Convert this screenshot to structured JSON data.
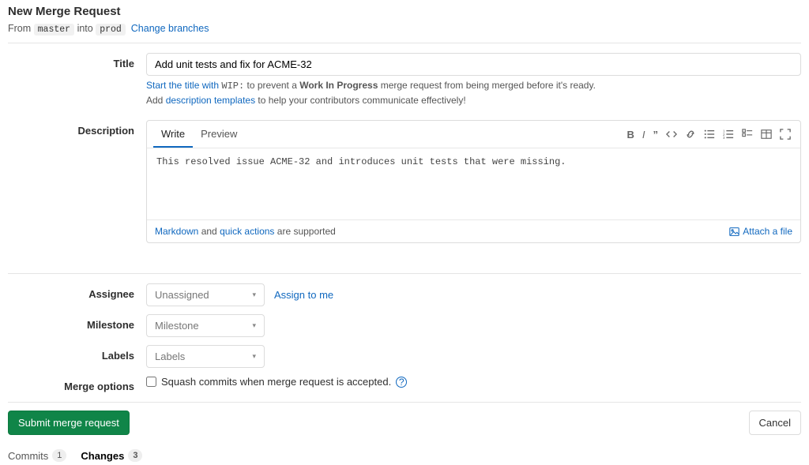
{
  "header": {
    "title": "New Merge Request",
    "from_label": "From",
    "from_branch": "master",
    "into_label": "into",
    "to_branch": "prod",
    "change_branches": "Change branches"
  },
  "form": {
    "title_label": "Title",
    "title_value": "Add unit tests and fix for ACME-32",
    "hint1_prefix": "Start the title with ",
    "hint1_code": "WIP:",
    "hint1_mid": " to prevent a ",
    "hint1_bold": "Work In Progress",
    "hint1_suffix": " merge request from being merged before it's ready.",
    "hint2_prefix": "Add ",
    "hint2_link": "description templates",
    "hint2_suffix": " to help your contributors communicate effectively!",
    "description_label": "Description",
    "tab_write": "Write",
    "tab_preview": "Preview",
    "description_value": "This resolved issue ACME-32 and introduces unit tests that were missing.",
    "footer_prefix": "",
    "footer_markdown": "Markdown",
    "footer_and": " and ",
    "footer_quick": "quick actions",
    "footer_suffix": " are supported",
    "attach_label": "Attach a file",
    "assignee_label": "Assignee",
    "assignee_value": "Unassigned",
    "assign_to_me": "Assign to me",
    "milestone_label": "Milestone",
    "milestone_value": "Milestone",
    "labels_label": "Labels",
    "labels_value": "Labels",
    "merge_options_label": "Merge options",
    "squash_label": "Squash commits when merge request is accepted."
  },
  "actions": {
    "submit": "Submit merge request",
    "cancel": "Cancel"
  },
  "tabs": {
    "commits_label": "Commits",
    "commits_count": "1",
    "changes_label": "Changes",
    "changes_count": "3"
  }
}
